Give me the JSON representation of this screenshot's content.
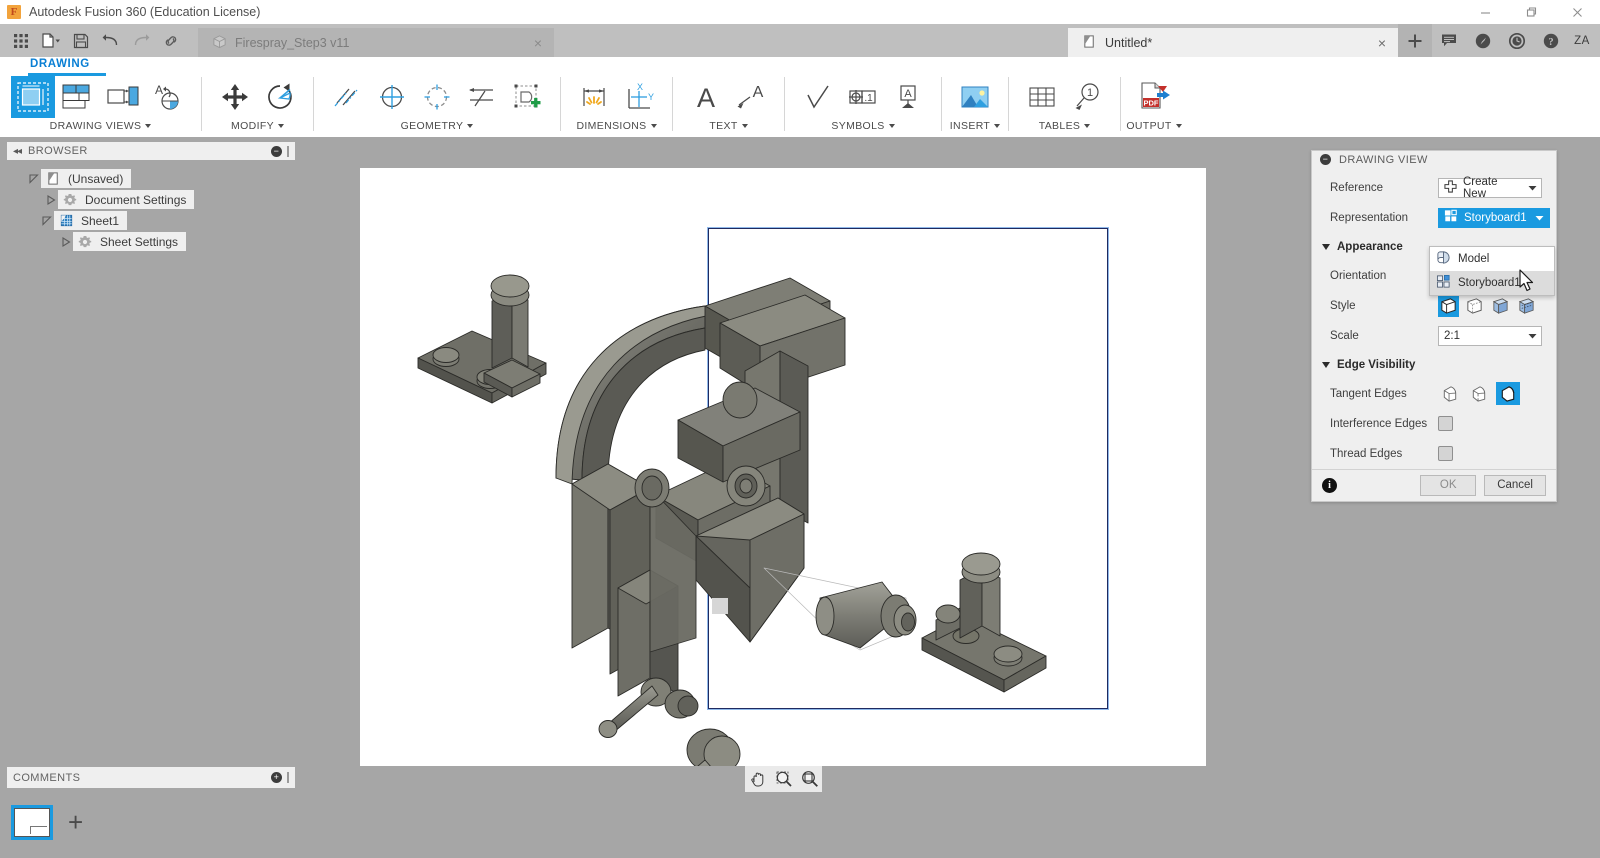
{
  "window": {
    "title": "Autodesk Fusion 360 (Education License)",
    "logo_letter": "F",
    "controls": {
      "minimize": "minimize-icon",
      "restore": "restore-icon",
      "close": "close-icon"
    }
  },
  "quick_access": {
    "buttons": [
      {
        "name": "app-grid-icon",
        "label": "Show Data Panel"
      },
      {
        "name": "file-icon",
        "label": "File"
      },
      {
        "name": "save-icon",
        "label": "Save"
      },
      {
        "name": "undo-icon",
        "label": "Undo"
      },
      {
        "name": "redo-icon",
        "label": "Redo"
      },
      {
        "name": "link-icon",
        "label": "Link"
      }
    ]
  },
  "tabs": [
    {
      "label": "Firespray_Step3 v11",
      "active": false,
      "close": "×",
      "icon": "cube-icon"
    },
    {
      "label": "Untitled*",
      "active": true,
      "close": "×",
      "icon": "drawing-icon"
    }
  ],
  "tab_actions": {
    "new_tab": "+",
    "icons": [
      {
        "name": "comment-icon"
      },
      {
        "name": "speedometer-icon"
      },
      {
        "name": "clock-history-icon"
      },
      {
        "name": "help-icon"
      }
    ],
    "avatar_initials": "ZA"
  },
  "ribbon": {
    "active_tab": "DRAWING",
    "groups": [
      {
        "label": "DRAWING VIEWS",
        "has_caret": true,
        "icons": [
          {
            "name": "base-view-icon",
            "selected": true
          },
          {
            "name": "projected-view-icon",
            "selected": false
          },
          {
            "name": "detail-view-icon",
            "selected": false
          },
          {
            "name": "auxiliary-view-icon",
            "selected": false
          }
        ]
      },
      {
        "label": "MODIFY",
        "has_caret": true,
        "icons": [
          {
            "name": "move-icon",
            "selected": false
          },
          {
            "name": "rotate-icon",
            "selected": false
          }
        ]
      },
      {
        "label": "GEOMETRY",
        "has_caret": true,
        "icons": [
          {
            "name": "centerline-icon",
            "selected": false
          },
          {
            "name": "center-mark-icon",
            "selected": false
          },
          {
            "name": "bolt-circle-icon",
            "selected": false
          },
          {
            "name": "edge-extension-icon",
            "selected": false
          },
          {
            "name": "sketch-icon",
            "selected": false
          }
        ]
      },
      {
        "label": "DIMENSIONS",
        "has_caret": true,
        "icons": [
          {
            "name": "dimension-icon",
            "selected": false
          },
          {
            "name": "ordinate-dimension-icon",
            "selected": false
          }
        ]
      },
      {
        "label": "TEXT",
        "has_caret": true,
        "icons": [
          {
            "name": "text-icon",
            "selected": false
          },
          {
            "name": "leader-text-icon",
            "selected": false
          }
        ]
      },
      {
        "label": "SYMBOLS",
        "has_caret": true,
        "icons": [
          {
            "name": "surface-texture-icon",
            "selected": false
          },
          {
            "name": "feature-control-frame-icon",
            "selected": false
          },
          {
            "name": "datum-identifier-icon",
            "selected": false
          }
        ]
      },
      {
        "label": "INSERT",
        "has_caret": true,
        "icons": [
          {
            "name": "insert-image-icon",
            "selected": false
          }
        ]
      },
      {
        "label": "TABLES",
        "has_caret": true,
        "icons": [
          {
            "name": "table-icon",
            "selected": false
          },
          {
            "name": "balloon-icon",
            "selected": false
          }
        ]
      },
      {
        "label": "OUTPUT",
        "has_caret": true,
        "icons": [
          {
            "name": "export-pdf-icon",
            "selected": false
          }
        ]
      }
    ]
  },
  "browser": {
    "title": "BROWSER",
    "collapse_icon": "◂◂",
    "minus_icon": "−",
    "tree": [
      {
        "label": "(Unsaved)",
        "icon": "drawing-doc-icon",
        "indent": 0,
        "arrow": "expanded"
      },
      {
        "label": "Document Settings",
        "icon": "gear-icon",
        "indent": 1,
        "arrow": "collapsed"
      },
      {
        "label": "Sheet1",
        "icon": "sheet-icon",
        "indent": 1,
        "arrow": "expanded"
      },
      {
        "label": "Sheet Settings",
        "icon": "gear-icon",
        "indent": 2,
        "arrow": "collapsed"
      }
    ]
  },
  "comments": {
    "title": "COMMENTS",
    "plus_icon": "+"
  },
  "sheet_bar": {
    "sheet_thumbnail": "sheet1-thumbnail",
    "add_sheet": "+"
  },
  "canvas": {
    "nav_buttons": [
      {
        "name": "pan-icon"
      },
      {
        "name": "zoom-window-icon"
      },
      {
        "name": "zoom-fit-icon"
      }
    ],
    "view_model": "firespray-isometric-assembly"
  },
  "dialog": {
    "title": "DRAWING VIEW",
    "collapse_icon": "−",
    "rows": {
      "reference_label": "Reference",
      "reference_value": "Create New",
      "reference_icon": "create-new-icon",
      "representation_label": "Representation",
      "representation_value": "Storyboard1",
      "representation_icon": "storyboard-icon",
      "appearance_section": "Appearance",
      "orientation_label": "Orientation",
      "orientation_value": "",
      "style_label": "Style",
      "scale_label": "Scale",
      "scale_value": "2:1",
      "edge_visibility_section": "Edge Visibility",
      "tangent_edges_label": "Tangent Edges",
      "interference_edges_label": "Interference Edges",
      "thread_edges_label": "Thread Edges"
    },
    "representation_options": [
      {
        "label": "Model",
        "icon": "model-icon",
        "hover": false
      },
      {
        "label": "Storyboard1",
        "icon": "storyboard-icon",
        "hover": true
      }
    ],
    "style_buttons": [
      {
        "name": "visible-edges-style-icon",
        "selected": true
      },
      {
        "name": "visible-hidden-edges-style-icon",
        "selected": false
      },
      {
        "name": "shaded-style-icon",
        "selected": false
      },
      {
        "name": "shaded-hidden-edges-style-icon",
        "selected": false
      }
    ],
    "tangent_edges_buttons": [
      {
        "name": "tangent-off-icon",
        "selected": false
      },
      {
        "name": "tangent-shortened-icon",
        "selected": false
      },
      {
        "name": "tangent-full-icon",
        "selected": true
      }
    ],
    "checkboxes": [
      {
        "name": "interference-edges-checkbox",
        "checked": false
      },
      {
        "name": "thread-edges-checkbox",
        "checked": false
      }
    ],
    "footer": {
      "info": "i",
      "ok": "OK",
      "cancel": "Cancel"
    }
  },
  "colors": {
    "accent": "#1a9ae0",
    "chrome": "#a6a6a6",
    "panel": "#efefef",
    "ribbon_tab": "#0a7fd4",
    "view_border": "#1f2a60",
    "view_glow": "#8fb8ea"
  }
}
